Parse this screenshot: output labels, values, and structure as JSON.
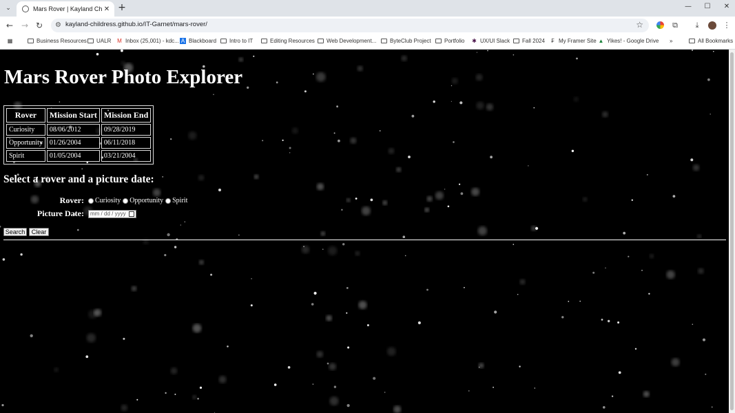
{
  "browser": {
    "tab": {
      "title": "Mars Rover | Kayland Childress",
      "close": "✕"
    },
    "new_tab": "+",
    "window_controls": {
      "minimize": "—",
      "maximize": "☐",
      "close": "✕"
    },
    "address_bar": {
      "url": "kayland-childress.github.io/IT-Garnet/mars-rover/"
    },
    "bookmarks": [
      {
        "label": "Business Resources",
        "icon": "folder-icon"
      },
      {
        "label": "UALR",
        "icon": "folder-icon"
      },
      {
        "label": "Inbox (25,001) - kdc...",
        "icon": "gmail-icon"
      },
      {
        "label": "Blackboard",
        "icon": "blackboard-icon"
      },
      {
        "label": "Intro to IT",
        "icon": "folder-icon"
      },
      {
        "label": "Editing Resources",
        "icon": "folder-icon"
      },
      {
        "label": "Web Development...",
        "icon": "folder-icon"
      },
      {
        "label": "ByteClub Project",
        "icon": "folder-icon"
      },
      {
        "label": "Portfolio",
        "icon": "folder-icon"
      },
      {
        "label": "UX/UI Slack",
        "icon": "slack-icon"
      },
      {
        "label": "Fall 2024",
        "icon": "folder-icon"
      },
      {
        "label": "My Framer Site",
        "icon": "framer-icon"
      },
      {
        "label": "Yikes! - Google Drive",
        "icon": "drive-icon"
      }
    ],
    "more_bookmarks": "»",
    "all_bookmarks": "All Bookmarks"
  },
  "page": {
    "title": "Mars Rover Photo Explorer",
    "table": {
      "headers": [
        "Rover",
        "Mission Start",
        "Mission End"
      ],
      "rows": [
        [
          "Curiosity",
          "08/06/2012",
          "09/28/2019"
        ],
        [
          "Opportunity",
          "01/26/2004",
          "06/11/2018"
        ],
        [
          "Spirit",
          "01/05/2004",
          "03/21/2004"
        ]
      ]
    },
    "instructions": "Select a rover and a picture date:",
    "rover_label": "Rover:",
    "rover_options": [
      "Curiosity",
      "Opportunity",
      "Spirit"
    ],
    "date_label": "Picture Date:",
    "date_placeholder": "mm / dd / yyyy",
    "search_button": "Search",
    "clear_button": "Clear"
  },
  "colors": {
    "page_background": "#000000",
    "text": "#ffffff",
    "chrome_tabstrip": "#dfe3e8"
  }
}
